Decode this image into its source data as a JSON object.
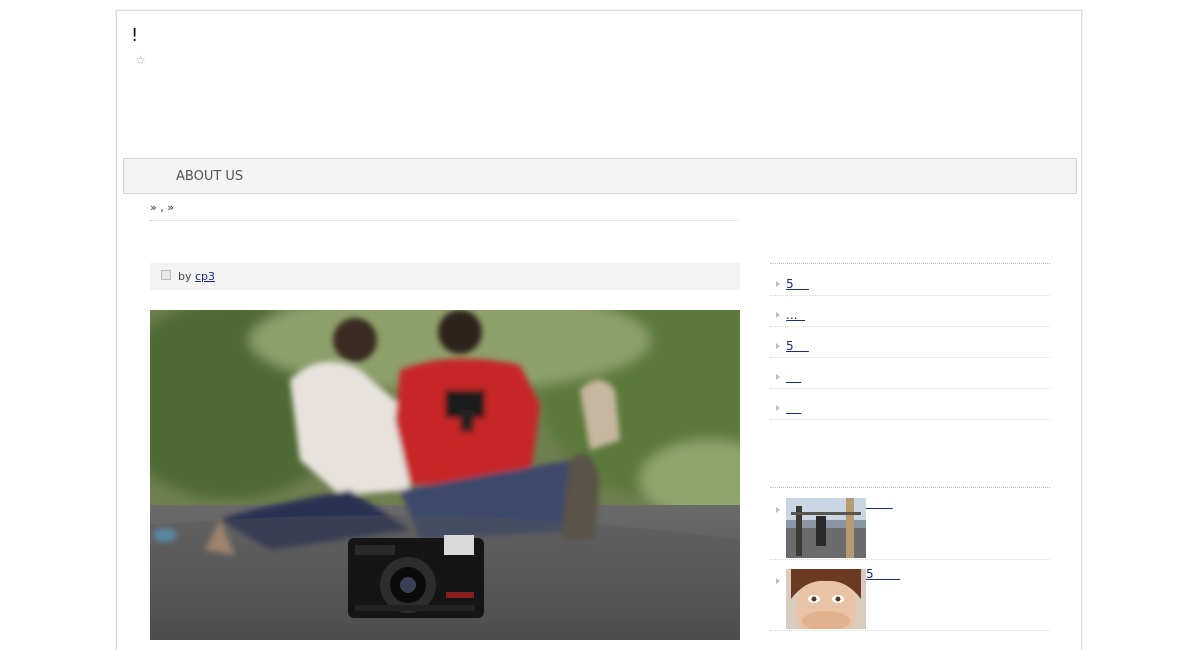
{
  "header": {
    "site_title": "!",
    "star_icon": "star-icon"
  },
  "nav": {
    "items": [
      {
        "label": "ABOUT US"
      }
    ]
  },
  "breadcrumb": {
    "text": "» , »"
  },
  "post": {
    "by_label": "by",
    "author": "cp3"
  },
  "sidebar": {
    "recent_links": [
      {
        "label": "5    "
      },
      {
        "label": "...  "
      },
      {
        "label": "5    "
      },
      {
        "label": "    "
      },
      {
        "label": "    "
      }
    ],
    "thumb_links": [
      {
        "label": "       "
      },
      {
        "label": "5       "
      }
    ]
  },
  "colors": {
    "link": "#1a2a8c",
    "nav_bg": "#f4f4f4",
    "meta_bg": "#f3f3f3"
  }
}
